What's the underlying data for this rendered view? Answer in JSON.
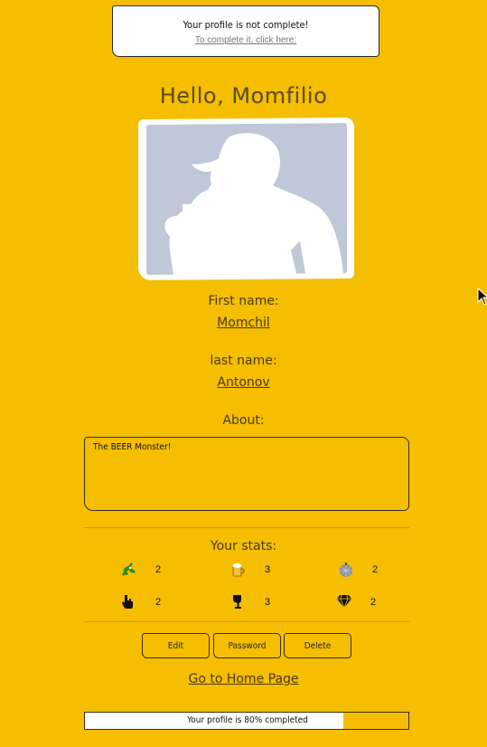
{
  "notice": {
    "title": "Your profile is not complete!",
    "link": "To complete it, click here:"
  },
  "greeting": "Hello, Momfilio",
  "profile": {
    "first_name_label": "First name:",
    "first_name": "Momchil",
    "last_name_label": "last name:",
    "last_name": "Antonov",
    "about_label": "About:",
    "about": "The BEER Monster!"
  },
  "stats": {
    "title": "Your stats:",
    "items": [
      {
        "icon": "mistletoe-icon",
        "value": "2"
      },
      {
        "icon": "beer-mug-icon",
        "value": "3"
      },
      {
        "icon": "disco-ball-icon",
        "value": "2"
      },
      {
        "icon": "hand-pointer-icon",
        "value": "2"
      },
      {
        "icon": "wine-glass-icon",
        "value": "3"
      },
      {
        "icon": "diamond-icon",
        "value": "2"
      }
    ]
  },
  "buttons": {
    "edit": "Edit",
    "password": "Password",
    "delete": "Delete"
  },
  "home_link": "Go to Home Page",
  "progress": {
    "label": "Your profile is 80% completed",
    "value": 0.8
  },
  "colors": {
    "background": "#f5be00",
    "text": "#4a3a10",
    "photo_silhouette": "#c0c7d8"
  }
}
